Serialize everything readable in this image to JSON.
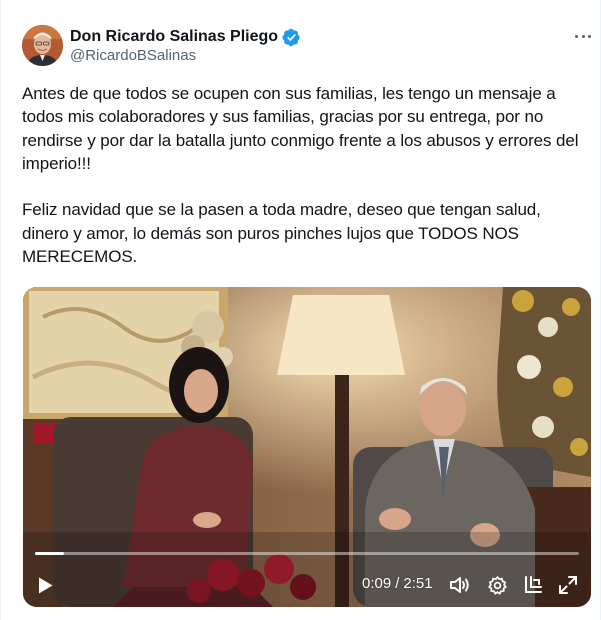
{
  "author": {
    "display_name": "Don Ricardo Salinas Pliego",
    "handle": "@RicardoBSalinas",
    "verified": true
  },
  "tweet": {
    "paragraphs": [
      "Antes de que todos se ocupen con sus familias, les tengo un mensaje a todos mis colaboradores y sus familias, gracias por su entrega, por no rendirse y por dar la batalla junto conmigo frente a los abusos y errores del imperio!!!",
      "Feliz navidad que se la pasen a toda madre, deseo que tengan salud, dinero y amor, lo demás son puros pinches lujos que TODOS NOS MERECEMOS."
    ]
  },
  "video": {
    "current_time": "0:09",
    "duration": "2:51",
    "progress_fraction": 0.053
  },
  "icons": {
    "more": "more-dots-icon",
    "verified": "verified-badge-icon",
    "play": "play-icon",
    "volume": "volume-icon",
    "settings": "gear-icon",
    "pip": "picture-in-picture-icon",
    "fullscreen": "fullscreen-icon"
  },
  "colors": {
    "verified_blue": "#1d9bf0",
    "text_primary": "#0f1419",
    "text_secondary": "#536471"
  }
}
